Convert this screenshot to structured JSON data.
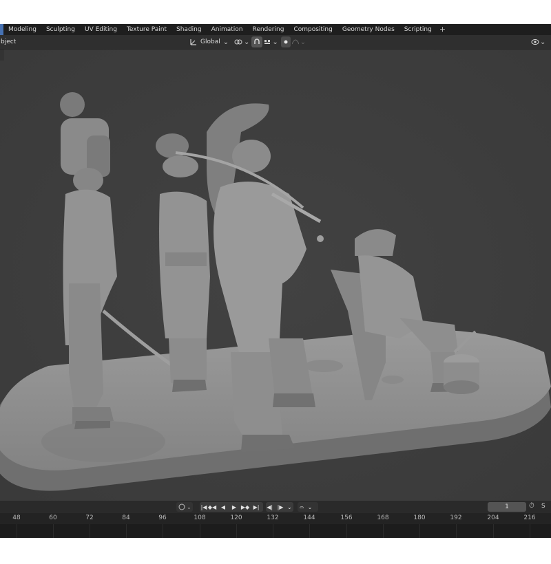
{
  "topbar": {
    "tabs": [
      "Modeling",
      "Sculpting",
      "UV Editing",
      "Texture Paint",
      "Shading",
      "Animation",
      "Rendering",
      "Compositing",
      "Geometry Nodes",
      "Scripting"
    ],
    "add_label": "+"
  },
  "header": {
    "mode_label": "bject",
    "transform_orientation": "Global",
    "icons": [
      "transform-orientation-icon",
      "pivot-icon",
      "snap-icon",
      "snap-target-icon",
      "proportional-edit-icon",
      "falloff-icon",
      "overlay-icon"
    ]
  },
  "viewport": {
    "scene": "Sculpted diorama of Napoleonic soldiers on an oval base, seated figure on chair beside a drum"
  },
  "timeline": {
    "current_frame": "1",
    "extra_label": "S",
    "ruler_ticks": [
      "48",
      "60",
      "72",
      "84",
      "96",
      "108",
      "120",
      "132",
      "144",
      "156",
      "168",
      "180",
      "192",
      "204",
      "216"
    ],
    "playback_icons": [
      "jump-start-icon",
      "prev-keyframe-icon",
      "play-reverse-icon",
      "play-icon",
      "next-keyframe-icon",
      "jump-end-icon"
    ]
  },
  "colors": {
    "accent": "#4772b3",
    "viewport_bg": "#3d3d3d",
    "model_gray": "#8e8e8e"
  }
}
